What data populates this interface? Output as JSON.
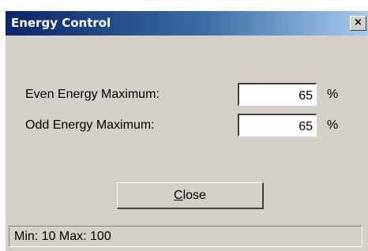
{
  "window": {
    "title": "Energy Control",
    "close_glyph": "×"
  },
  "form": {
    "even_label": "Even Energy Maximum:",
    "even_value": "65",
    "even_unit": "%",
    "odd_label": "Odd Energy Maximum:",
    "odd_value": "65",
    "odd_unit": "%"
  },
  "buttons": {
    "close_mnemonic": "C",
    "close_rest": "lose"
  },
  "status": {
    "text": "Min: 10 Max: 100"
  },
  "colors": {
    "titlebar_start": "#0a246a",
    "titlebar_end": "#a6caf0",
    "dialog_bg": "#d4d0c8"
  }
}
